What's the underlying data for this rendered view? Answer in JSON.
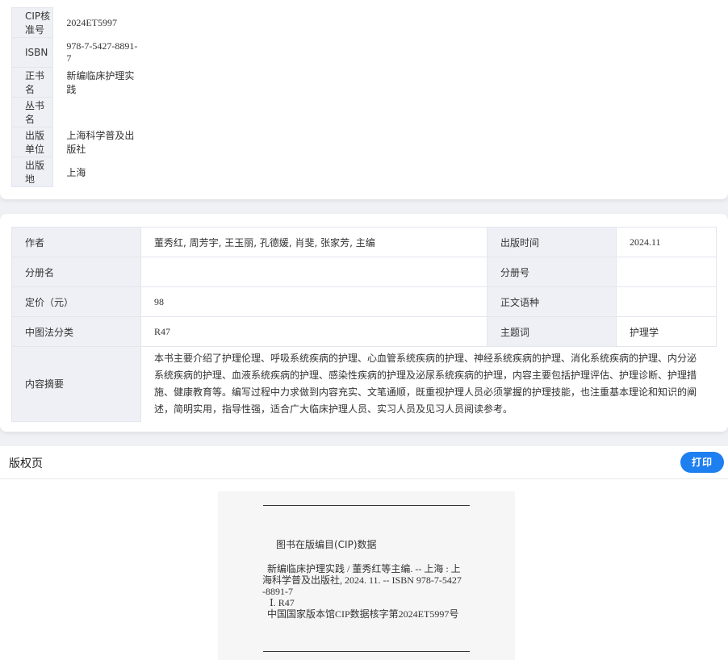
{
  "basic": {
    "rows": [
      {
        "label": "CIP核准号",
        "value": "2024ET5997"
      },
      {
        "label": "ISBN",
        "value": "978-7-5427-8891-7"
      },
      {
        "label": "正书名",
        "value": "新编临床护理实践"
      },
      {
        "label": "丛书名",
        "value": ""
      },
      {
        "label": "出版单位",
        "value": "上海科学普及出版社"
      },
      {
        "label": "出版地",
        "value": "上海"
      }
    ]
  },
  "detail": {
    "author_label": "作者",
    "author": "董秀红, 周芳宇, 王玉丽, 孔德媛, 肖斐, 张家芳, 主编",
    "pubtime_label": "出版时间",
    "pubtime": "2024.11",
    "volume_label": "分册名",
    "volume": "",
    "volno_label": "分册号",
    "volno": "",
    "price_label": "定价（元）",
    "price": "98",
    "lang_label": "正文语种",
    "lang": "",
    "clc_label": "中图法分类",
    "clc": "R47",
    "subject_label": "主题词",
    "subject": "护理学",
    "summary_label": "内容摘要",
    "summary": "本书主要介绍了护理伦理、呼吸系统疾病的护理、心血管系统疾病的护理、神经系统疾病的护理、消化系统疾病的护理、内分泌系统疾病的护理、血液系统疾病的护理、感染性疾病的护理及泌尿系统疾病的护理，内容主要包括护理评估、护理诊断、护理措施、健康教育等。编写过程中力求做到内容充实、文笔通顺，既重视护理人员必须掌握的护理技能，也注重基本理论和知识的阐述，简明实用，指导性强，适合广大临床护理人员、实习人员及见习人员阅读参考。"
  },
  "section": {
    "title": "版权页",
    "print_label": "打印"
  },
  "cip": {
    "heading": "图书在版编目(CIP)数据",
    "lines": [
      "  新编临床护理实践 / 董秀红等主编. -- 上海 : 上",
      "海科学普及出版社, 2024. 11. -- ISBN 978-7-5427",
      "-8891-7",
      "   Ⅰ. R47",
      "  中国国家版本馆CIP数据核字第2024ET5997号"
    ]
  }
}
